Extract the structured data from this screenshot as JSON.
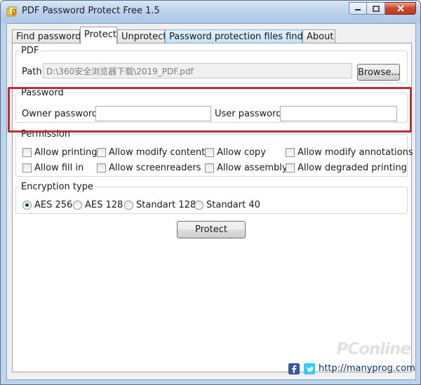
{
  "window": {
    "title": "PDF Password Protect Free 1.5"
  },
  "tabs": [
    {
      "label": "Find password"
    },
    {
      "label": "Protect"
    },
    {
      "label": "Unprotect"
    },
    {
      "label": "Password protection files finder"
    },
    {
      "label": "About"
    }
  ],
  "pdf_group": {
    "legend": "PDF",
    "path_label": "Path",
    "path_value": "D:\\360安全浏览器下载\\2019_PDF.pdf",
    "browse_label": "Browse..."
  },
  "password_group": {
    "legend": "Password",
    "owner_label": "Owner password",
    "owner_value": "",
    "user_label": "User password",
    "user_value": ""
  },
  "permission_group": {
    "legend": "Permission",
    "items": [
      {
        "label": "Allow printing"
      },
      {
        "label": "Allow modify contents"
      },
      {
        "label": "Allow copy"
      },
      {
        "label": "Allow modify annotations"
      },
      {
        "label": "Allow fill in"
      },
      {
        "label": "Allow screenreaders"
      },
      {
        "label": "Allow assembly"
      },
      {
        "label": "Allow degraded printing"
      }
    ]
  },
  "encryption_group": {
    "legend": "Encryption type",
    "options": [
      {
        "label": "AES 256",
        "selected": true
      },
      {
        "label": "AES 128",
        "selected": false
      },
      {
        "label": "Standart 128",
        "selected": false
      },
      {
        "label": "Standart 40",
        "selected": false
      }
    ]
  },
  "protect_button": "Protect",
  "footer": {
    "link": "http://manyprog.com",
    "watermark": "PConline"
  },
  "colors": {
    "highlight_border": "#b3323a",
    "facebook": "#3b5998",
    "twitter": "#33ccff"
  }
}
